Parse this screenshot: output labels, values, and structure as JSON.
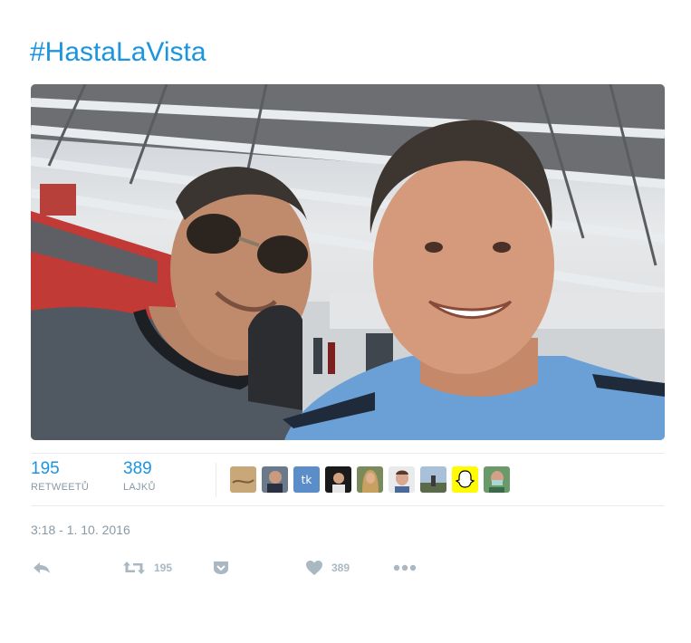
{
  "tweet": {
    "hashtag": "#HastaLaVista",
    "retweets": {
      "count": "195",
      "label": "RETWEETŮ"
    },
    "likes": {
      "count": "389",
      "label": "LAJKŮ"
    },
    "timestamp": "3:18 - 1. 10. 2016",
    "actions": {
      "reply_icon": "reply-icon",
      "retweet_icon": "retweet-icon",
      "retweet_count": "195",
      "save_icon": "save-icon",
      "like_icon": "heart-icon",
      "like_count": "389",
      "more_icon": "more-icon"
    },
    "avatars": [
      {
        "icon": "avatar-sand"
      },
      {
        "icon": "avatar-photo"
      },
      {
        "icon": "avatar-tk",
        "text": "tk"
      },
      {
        "icon": "avatar-dark"
      },
      {
        "icon": "avatar-hair"
      },
      {
        "icon": "avatar-face"
      },
      {
        "icon": "avatar-outdoor"
      },
      {
        "icon": "avatar-snapchat"
      },
      {
        "icon": "avatar-mask"
      }
    ]
  },
  "colors": {
    "link": "#1b95e0",
    "muted": "#8899a6",
    "icon": "#aab8c2",
    "border": "#e6ecf0"
  }
}
